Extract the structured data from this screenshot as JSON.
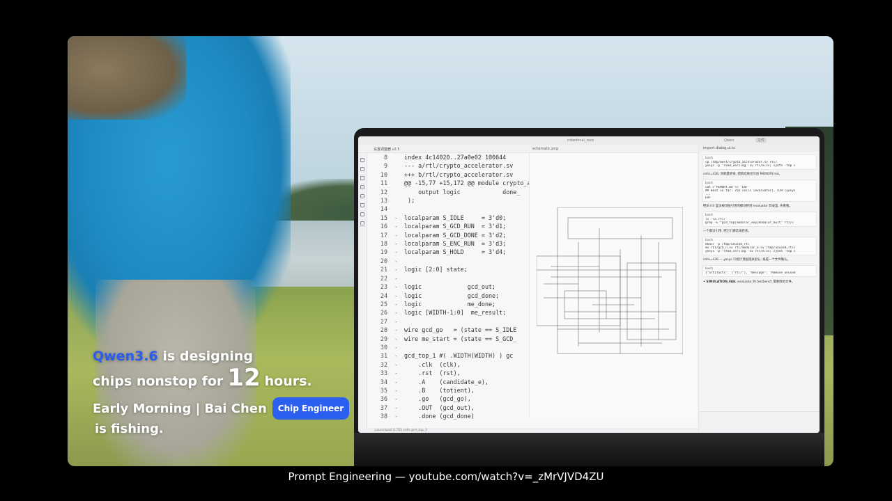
{
  "overlay": {
    "brand": "Qwen3.6",
    "line1_rest": "is designing",
    "line2_pre": "chips nonstop for",
    "line2_big": "12",
    "line2_post": "hours.",
    "line3": "Early Morning | Bai Chen",
    "badge": "Chip Engineer",
    "line4": "is fishing."
  },
  "window": {
    "title": "mbedonal_reco",
    "user": "Qwen",
    "toolbar_button": "文件"
  },
  "tabs": [
    "设置调整器 v2.5",
    "schematic.png"
  ],
  "code": [
    {
      "ln": "8",
      "d": "",
      "t": "index 4c14020..27a0e02 100644"
    },
    {
      "ln": "9",
      "d": "",
      "t": "--- a/rtl/crypto_accelerator.sv"
    },
    {
      "ln": "10",
      "d": "",
      "t": "+++ b/rtl/crypto_accelerator.sv"
    },
    {
      "ln": "11",
      "d": "",
      "t": "@@ -15,77 +15,172 @@ module crypto_a"
    },
    {
      "ln": "12",
      "d": "",
      "t": "    output logic            done_"
    },
    {
      "ln": "13",
      "d": "",
      "t": " );"
    },
    {
      "ln": "14",
      "d": "",
      "t": ""
    },
    {
      "ln": "15",
      "d": "-",
      "t": "localparam S_IDLE     = 3'd0;"
    },
    {
      "ln": "16",
      "d": "-",
      "t": "localparam S_GCD_RUN  = 3'd1;"
    },
    {
      "ln": "17",
      "d": "-",
      "t": "localparam S_GCD_DONE = 3'd2;"
    },
    {
      "ln": "18",
      "d": "-",
      "t": "localparam S_ENC_RUN  = 3'd3;"
    },
    {
      "ln": "19",
      "d": "-",
      "t": "localparam S_HOLD     = 3'd4;"
    },
    {
      "ln": "20",
      "d": "-",
      "t": ""
    },
    {
      "ln": "21",
      "d": "-",
      "t": "logic [2:0] state;"
    },
    {
      "ln": "22",
      "d": "-",
      "t": ""
    },
    {
      "ln": "23",
      "d": "-",
      "t": "logic             gcd_out;"
    },
    {
      "ln": "24",
      "d": "-",
      "t": "logic             gcd_done;"
    },
    {
      "ln": "25",
      "d": "-",
      "t": "logic             me_done;"
    },
    {
      "ln": "26",
      "d": "-",
      "t": "logic [WIDTH-1:0]  me_result;"
    },
    {
      "ln": "27",
      "d": "-",
      "t": ""
    },
    {
      "ln": "28",
      "d": "-",
      "t": "wire gcd_go   = (state == S_IDLE"
    },
    {
      "ln": "29",
      "d": "-",
      "t": "wire me_start = (state == S_GCD_"
    },
    {
      "ln": "30",
      "d": "-",
      "t": ""
    },
    {
      "ln": "31",
      "d": "-",
      "t": "gcd_top_1 #( .WIDTH(WIDTH) ) gc"
    },
    {
      "ln": "32",
      "d": "-",
      "t": "    .clk  (clk),"
    },
    {
      "ln": "33",
      "d": "-",
      "t": "    .rst  (rst),"
    },
    {
      "ln": "34",
      "d": "-",
      "t": "    .A    (candidate_e),"
    },
    {
      "ln": "35",
      "d": "-",
      "t": "    .B    (totient),"
    },
    {
      "ln": "36",
      "d": "-",
      "t": "    .go   (gcd_go),"
    },
    {
      "ln": "37",
      "d": "-",
      "t": "    .OUT  (gcd_out),"
    },
    {
      "ln": "38",
      "d": "-",
      "t": "    .done (gcd_done)"
    }
  ],
  "chat": {
    "header": "import dialog.ui.ts",
    "blocks": [
      {
        "label": "bash",
        "lines": [
          "cp /tmp/best/crypto_accelerator.sv rtl/",
          "yosys -p \"read_verilog -sv rtl/m.sv; synth -top c"
        ]
      },
      {
        "label": "bash",
        "lines": [
          "cat > PEMORY.md << 'EOF'",
          "## Best so far: 765 cells (evaluator), 419 (yosys",
          "...",
          "EOF"
        ]
      },
      {
        "label": "bash",
        "lines": [
          "ls -la rtl/",
          "grep -E \"gcd_top|modular_exp|modular_mult\" rtl/c"
        ]
      },
      {
        "label": "bash",
        "lines": [
          "mkdir -p /tmp/unused_rtl",
          "mv rtl/gcd_n.sv rtl/modular_e.sv /tmp/unused_rtl/",
          "yosys -p \"read_verilog -sv rtl/m.sv; synth -top c"
        ]
      },
      {
        "label": "bash",
        "lines": [
          "{\"artifacts\": [\"rtl/\"], \"message\": \"Remove unused"
        ]
      }
    ],
    "messages": [
      "cells=436, 消耗量更低, 把新结果也写进 MEMORY.md。",
      "把旧 rtl/ 里没被顶层引用的模块移到 evaluator 目录里, 先看看。",
      "一个都没引用, 把它们挪走再检查。",
      "cells=436 — yosys 只统计顶层相关部分, 再提一个文件确认。"
    ],
    "fail": "• SIMULATION_FAIL",
    "fail_detail": "evaluator 的 testbench 需要原始文件。"
  },
  "status_text": "Launchpad   0.765 cells   gcd_top_1",
  "caption": "Prompt Engineering — youtube.com/watch?v=_zMrVJVD4ZU"
}
